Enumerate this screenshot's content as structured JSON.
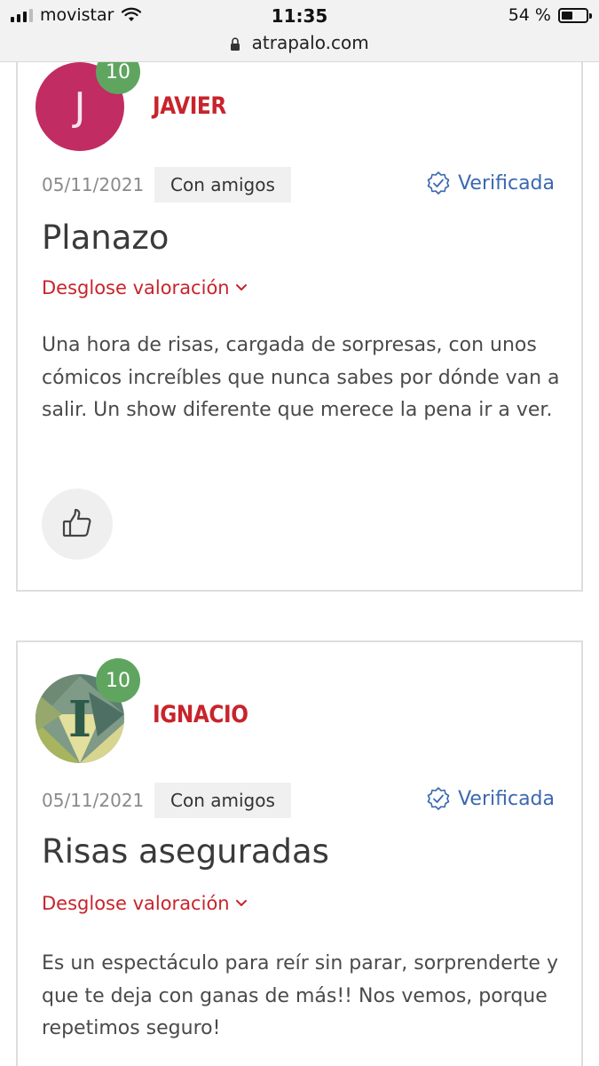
{
  "status_bar": {
    "carrier": "movistar",
    "time": "11:35",
    "battery_percent": "54 %",
    "battery_level": 0.54
  },
  "address_bar": {
    "url": "atrapalo.com"
  },
  "reviews": [
    {
      "user": {
        "initial": "J",
        "name": "JAVIER",
        "avatar_color": "#c12c63"
      },
      "score": "10",
      "date": "05/11/2021",
      "tag": "Con amigos",
      "verified_label": "Verificada",
      "title": "Planazo",
      "breakdown_label": "Desglose valoración",
      "body": "Una hora de risas, cargada de sorpresas, con unos cómicos increíbles que nunca sabes por dónde van a salir. Un show diferente que merece la pena ir a ver."
    },
    {
      "user": {
        "initial": "I",
        "name": "IGNACIO"
      },
      "score": "10",
      "date": "05/11/2021",
      "tag": "Con amigos",
      "verified_label": "Verificada",
      "title": "Risas aseguradas",
      "breakdown_label": "Desglose valoración",
      "body": "Es un espectáculo para reír sin parar, sorprenderte y que te deja con ganas de más!! Nos vemos, porque repetimos seguro!"
    }
  ],
  "colors": {
    "accent_red": "#c8242b",
    "verified_blue": "#3a68b0",
    "score_green": "#5fa55f"
  },
  "icons": [
    "signal-icon",
    "wifi-icon",
    "battery-icon",
    "lock-icon",
    "verified-icon",
    "chevron-down-icon",
    "thumbs-up-icon"
  ]
}
